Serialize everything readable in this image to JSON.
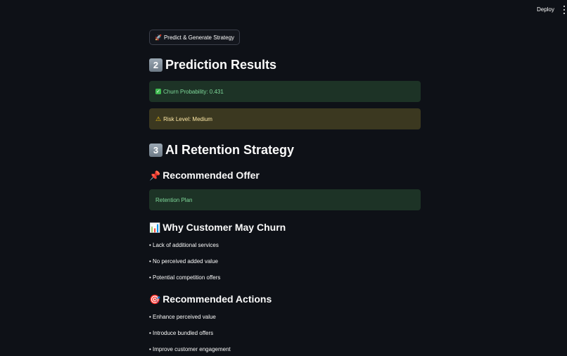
{
  "header": {
    "deploy_label": "Deploy"
  },
  "main": {
    "predict_button": {
      "icon": "🚀",
      "label": "Predict & Generate Strategy"
    },
    "prediction_section": {
      "number": "2",
      "title": "Prediction Results"
    },
    "churn_alert": {
      "icon": "✓",
      "text": "Churn Probability: 0.431"
    },
    "risk_alert": {
      "icon": "⚠",
      "text": "Risk Level: Medium"
    },
    "strategy_section": {
      "number": "3",
      "title": "AI Retention Strategy"
    },
    "offer_heading": {
      "icon": "📌",
      "title": "Recommended Offer"
    },
    "offer_value": "Retention Plan",
    "churn_reasons_heading": {
      "icon": "📊",
      "title": "Why Customer May Churn"
    },
    "churn_reasons": [
      "• Lack of additional services",
      "• No perceived added value",
      "• Potential competition offers"
    ],
    "actions_heading": {
      "icon": "🎯",
      "title": "Recommended Actions"
    },
    "actions": [
      "• Enhance perceived value",
      "• Introduce bundled offers",
      "• Improve customer engagement"
    ]
  },
  "colors": {
    "background": "#0e1117",
    "success_bg": "#1d3326",
    "success_text": "#7fd99a",
    "warning_bg": "#3b3820",
    "warning_text": "#ffe9a6"
  }
}
